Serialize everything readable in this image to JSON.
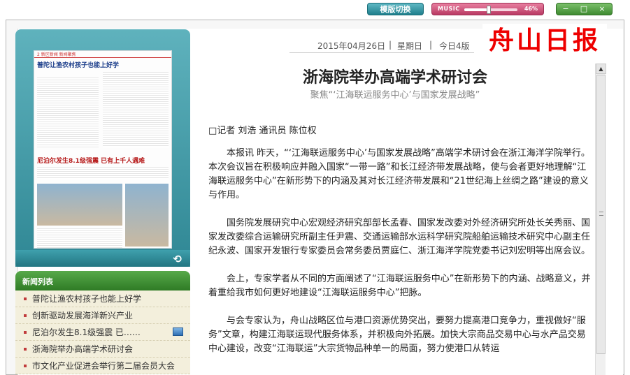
{
  "topbar": {
    "switch_label": "模版切换",
    "music_label": "MUSIC",
    "music_volume_percent": 46,
    "music_volume_text": "46%",
    "window_controls": [
      "−",
      "□",
      "×"
    ]
  },
  "masthead": "舟山日报",
  "datebar": {
    "date": "2015年04月26日",
    "weekday": "星期日",
    "pages": "今日4版"
  },
  "paper_thumbnail": {
    "page_label": "2  新区新闻  新闻聚焦",
    "headline_top": "普陀让渔农村孩子也能上好学",
    "headline_mid": "尼泊尔发生8.1级强震  已有上千人遇难"
  },
  "news_list": {
    "title": "新闻列表",
    "items": [
      "普陀让渔农村孩子也能上好学",
      "创新驱动发展海洋新兴产业",
      "尼泊尔发生8.1级强震  已……",
      "浙海院举办高端学术研讨会",
      "市文化产业促进会举行第二届会员大会"
    ]
  },
  "article": {
    "headline": "浙海院举办高端学术研讨会",
    "subtitle": "聚焦“‘江海联运服务中心’与国家发展战略”",
    "byline": "□记者  刘浩  通讯员  陈位权",
    "paragraphs": [
      "本报讯    昨天，“‘江海联运服务中心’与国家发展战略”高端学术研讨会在浙江海洋学院举行。本次会议旨在积极响应并融入国家“一带一路”和长江经济带发展战略，使与会者更好地理解“江海联运服务中心”在新形势下的内涵及其对长江经济带发展和“21世纪海上丝绸之路”建设的意义与作用。",
      "国务院发展研究中心宏观经济研究部部长孟春、国家发改委对外经济研究所处长关秀丽、国家发改委综合运输研究所副主任尹震、交通运输部水运科学研究院船舶运输技术研究中心副主任纪永波、国家开发银行专家委员会常务委员贾庭仁、浙江海洋学院党委书记刘宏明等出席会议。",
      "会上，专家学者从不同的方面阐述了“江海联运服务中心”在新形势下的内涵、战略意义，并着重给我市如何更好地建设“江海联运服务中心”把脉。",
      "与会专家认为，舟山战略区位与港口资源优势突出，要努力提高港口竞争力，重视做好“服务”文章，构建江海联运现代服务体系，并积极向外拓展。加快大宗商品交易中心与水产品交易中心建设，改变“江海联运”大宗货物品种单一的局面，努力使港口从转运"
    ]
  },
  "colors": {
    "teal": "#2f8794",
    "green": "#3e8a30",
    "pink": "#b83a63",
    "masthead_red": "#e00000"
  }
}
